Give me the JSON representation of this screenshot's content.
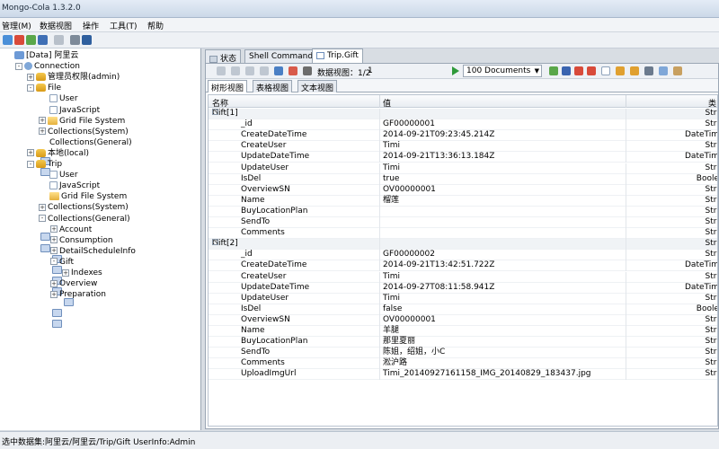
{
  "window": {
    "title": "Mongo-Cola  1.3.2.0"
  },
  "menu": [
    "管理(M)",
    "数据视图",
    "操作",
    "工具(T)",
    "帮助"
  ],
  "tree": [
    {
      "label": "[Data] 阿里云",
      "depth": 0,
      "icon": "root",
      "exp": ""
    },
    {
      "label": "Connection",
      "depth": 1,
      "icon": "conn",
      "exp": "-"
    },
    {
      "label": "管理员权限(admin)",
      "depth": 2,
      "icon": "db",
      "exp": "+"
    },
    {
      "label": "File",
      "depth": 2,
      "icon": "db",
      "exp": "-"
    },
    {
      "label": "User",
      "depth": 3,
      "icon": "page",
      "exp": ""
    },
    {
      "label": "JavaScript",
      "depth": 3,
      "icon": "page",
      "exp": ""
    },
    {
      "label": "Grid File System",
      "depth": 3,
      "icon": "folder",
      "exp": "+"
    },
    {
      "label": "Collections(System)",
      "depth": 3,
      "icon": "grid",
      "exp": "+"
    },
    {
      "label": "Collections(General)",
      "depth": 3,
      "icon": "grid",
      "exp": ""
    },
    {
      "label": "本地(local)",
      "depth": 2,
      "icon": "db",
      "exp": "+"
    },
    {
      "label": "Trip",
      "depth": 2,
      "icon": "db",
      "exp": "-"
    },
    {
      "label": "User",
      "depth": 3,
      "icon": "page",
      "exp": ""
    },
    {
      "label": "JavaScript",
      "depth": 3,
      "icon": "page",
      "exp": ""
    },
    {
      "label": "Grid File System",
      "depth": 3,
      "icon": "folder",
      "exp": ""
    },
    {
      "label": "Collections(System)",
      "depth": 3,
      "icon": "grid",
      "exp": "+"
    },
    {
      "label": "Collections(General)",
      "depth": 3,
      "icon": "grid",
      "exp": "-"
    },
    {
      "label": "Account",
      "depth": 4,
      "icon": "grid",
      "exp": "+"
    },
    {
      "label": "Consumption",
      "depth": 4,
      "icon": "grid",
      "exp": "+"
    },
    {
      "label": "DetailScheduleInfo",
      "depth": 4,
      "icon": "grid",
      "exp": "+"
    },
    {
      "label": "Gift",
      "depth": 4,
      "icon": "grid",
      "exp": "-"
    },
    {
      "label": "Indexes",
      "depth": 5,
      "icon": "grid",
      "exp": "+"
    },
    {
      "label": "Overview",
      "depth": 4,
      "icon": "grid",
      "exp": "+"
    },
    {
      "label": "Preparation",
      "depth": 4,
      "icon": "grid",
      "exp": "+"
    }
  ],
  "tabs": [
    "状态",
    "Shell Command",
    "Trip.Gift"
  ],
  "subtoolbar": {
    "view_label": "数据视图：1/2",
    "page_value": "1",
    "page_size": "100  Documents"
  },
  "viewtabs": [
    "树形视图",
    "表格视图",
    "文本视图"
  ],
  "grid": {
    "columns": [
      "名称",
      "值",
      "类"
    ],
    "rows": [
      {
        "group": true,
        "name": "Gift[1]",
        "value": "",
        "type": "Stri"
      },
      {
        "name": "_id",
        "value": "GF00000001",
        "type": "Stri"
      },
      {
        "name": "CreateDateTime",
        "value": "2014-09-21T09:23:45.214Z",
        "type": "DateTim"
      },
      {
        "name": "CreateUser",
        "value": "Timi",
        "type": "Stri"
      },
      {
        "name": "UpdateDateTime",
        "value": "2014-09-21T13:36:13.184Z",
        "type": "DateTim"
      },
      {
        "name": "UpdateUser",
        "value": "Timi",
        "type": "Stri"
      },
      {
        "name": "IsDel",
        "value": "true",
        "type": "Boole"
      },
      {
        "name": "OverviewSN",
        "value": "OV00000001",
        "type": "Stri"
      },
      {
        "name": "Name",
        "value": "榴莲",
        "type": "Stri"
      },
      {
        "name": "BuyLocationPlan",
        "value": "",
        "type": "Stri"
      },
      {
        "name": "SendTo",
        "value": "",
        "type": "Stri"
      },
      {
        "name": "Comments",
        "value": "",
        "type": "Stri"
      },
      {
        "group": true,
        "name": "Gift[2]",
        "value": "",
        "type": "Stri"
      },
      {
        "name": "_id",
        "value": "GF00000002",
        "type": "Stri"
      },
      {
        "name": "CreateDateTime",
        "value": "2014-09-21T13:42:51.722Z",
        "type": "DateTim"
      },
      {
        "name": "CreateUser",
        "value": "Timi",
        "type": "Stri"
      },
      {
        "name": "UpdateDateTime",
        "value": "2014-09-27T08:11:58.941Z",
        "type": "DateTim"
      },
      {
        "name": "UpdateUser",
        "value": "Timi",
        "type": "Stri"
      },
      {
        "name": "IsDel",
        "value": "false",
        "type": "Boole"
      },
      {
        "name": "OverviewSN",
        "value": "OV00000001",
        "type": "Stri"
      },
      {
        "name": "Name",
        "value": "羊腿",
        "type": "Stri"
      },
      {
        "name": "BuyLocationPlan",
        "value": "那里夏丽",
        "type": "Stri"
      },
      {
        "name": "SendTo",
        "value": "陈姐，绍姐，小C",
        "type": "Stri"
      },
      {
        "name": "Comments",
        "value": "淞沪路",
        "type": "Stri"
      },
      {
        "name": "UploadImgUrl",
        "value": "Timi_20140927161158_IMG_20140829_183437.jpg",
        "type": "Stri"
      }
    ]
  },
  "status": {
    "text": "选中数据集:阿里云/阿里云/Trip/Gift  UserInfo:Admin"
  }
}
